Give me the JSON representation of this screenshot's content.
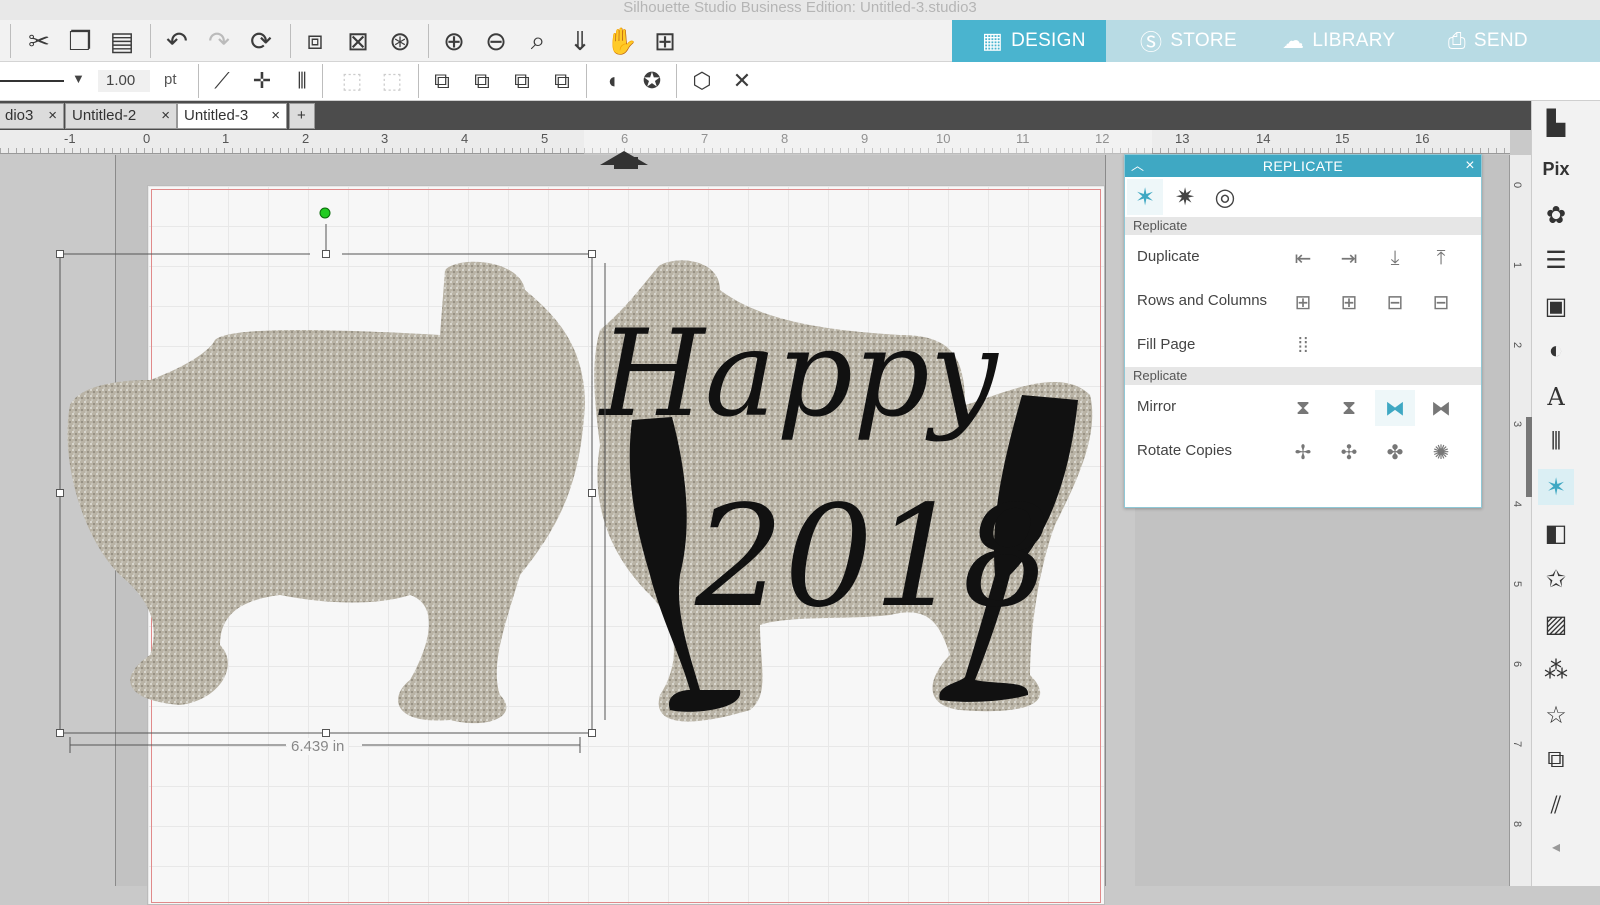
{
  "window": {
    "title": "Silhouette Studio Business Edition: Untitled-3.studio3"
  },
  "toolbar": {
    "icons": [
      "cut-icon",
      "copy-icon",
      "paste-icon",
      "undo-icon",
      "redo-icon",
      "redraw-icon",
      "group-icon",
      "ungroup-icon",
      "compound-icon",
      "zoom-in-icon",
      "zoom-out-icon",
      "zoom-select-icon",
      "pan-down-icon",
      "hand-icon",
      "fit-page-icon"
    ]
  },
  "modes": [
    {
      "label": "DESIGN",
      "icon": "grid-icon",
      "active": true
    },
    {
      "label": "STORE",
      "icon": "store-icon",
      "active": false
    },
    {
      "label": "LIBRARY",
      "icon": "cloud-icon",
      "active": false
    },
    {
      "label": "SEND",
      "icon": "printer-icon",
      "active": false
    }
  ],
  "line_settings": {
    "width_value": "1.00",
    "unit": "pt"
  },
  "tabs": [
    {
      "label": "dio3",
      "active": false
    },
    {
      "label": "Untitled-2",
      "active": false
    },
    {
      "label": "Untitled-3",
      "active": true
    }
  ],
  "add_tab_label": "+",
  "ruler": {
    "top_labels": [
      "-1",
      "0",
      "1",
      "2",
      "3",
      "4",
      "5",
      "6",
      "7",
      "8",
      "9",
      "10",
      "11",
      "12",
      "13",
      "14",
      "15",
      "16"
    ],
    "right_labels": [
      "0",
      "1",
      "2",
      "3",
      "4",
      "5",
      "6",
      "7",
      "8"
    ]
  },
  "canvas": {
    "selection_width": "6.439 in",
    "artwork_text_1": "Happy",
    "artwork_text_2": "2018"
  },
  "replicate_panel": {
    "title": "REPLICATE",
    "section1": "Replicate",
    "section2": "Replicate",
    "rows": [
      {
        "label": "Duplicate"
      },
      {
        "label": "Rows and Columns"
      },
      {
        "label": "Fill Page"
      },
      {
        "label": "Mirror"
      },
      {
        "label": "Rotate Copies"
      }
    ]
  },
  "colors": {
    "accent": "#3fa8c3",
    "glitter": "#bcb6a8",
    "ink": "#111111"
  }
}
